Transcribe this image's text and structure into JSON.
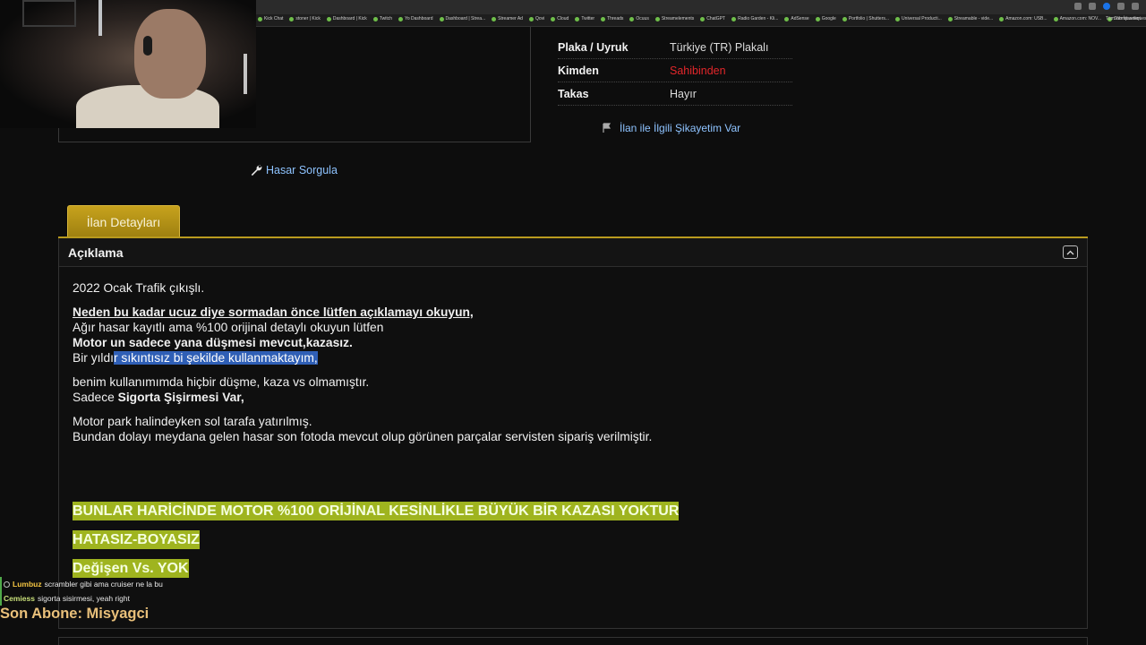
{
  "browser": {
    "bookmarks": [
      "Kick Chat",
      "stoner | Kick",
      "Dashboard | Kick",
      "Twitch",
      "Yo Dashboard",
      "Dashboard | Strea...",
      "Streamer Ad",
      "Qovi",
      "Cloud",
      "Twitter",
      "Threads",
      "Ocuus",
      "Streamelements",
      "ChatGPT",
      "Radio Garden - Kli...",
      "AdSense",
      "Google",
      "Portfolio | Shutters...",
      "Universal Producti...",
      "Streamable - vide...",
      "Amazon.com: USB...",
      "Amazon.com: NOV...",
      "Submit a request...",
      "Drive & Listen"
    ],
    "bookmarks_more": "Tüm Yer İşaretleri"
  },
  "info": {
    "rows": [
      {
        "key": "Plaka / Uyruk",
        "value": "Türkiye (TR) Plakalı"
      },
      {
        "key": "Kimden",
        "value": "Sahibinden"
      },
      {
        "key": "Takas",
        "value": "Hayır"
      }
    ],
    "complaint_link": "İlan ile İlgili Şikayetim Var"
  },
  "hasar_link": "Hasar Sorgula",
  "tab_label": "İlan Detayları",
  "section_title": "Açıklama",
  "description": {
    "line1": "2022 Ocak Trafik çıkışlı.",
    "line2": "Neden bu kadar ucuz  diye sormadan önce lütfen açıklamayı okuyun,",
    "line3": "Ağır hasar kayıtlı ama %100 orijinal detaylı okuyun lütfen",
    "line4": "Motor un sadece yana düşmesi mevcut,kazasız.",
    "line5_a": "Bir yıldı",
    "line5_b": "r sıkıntısız bi şekilde kullanmaktayım,",
    "line6": "benim kullanımımda hiçbir düşme, kaza vs olmamıştır.",
    "line7_a": "Sadece ",
    "line7_b": "Sigorta Şişirmesi Var,",
    "line8": "Motor park halindeyken sol tarafa yatırılmış.",
    "line9": "Bundan dolayı meydana gelen hasar son fotoda mevcut olup görünen parçalar servisten sipariş verilmiştir.",
    "hl1": "BUNLAR HARİCİNDE MOTOR %100 ORİJİNAL KESİNLİKLE BÜYÜK BİR KAZASI YOKTUR",
    "hl2": "HATASIZ-BOYASIZ",
    "hl3": "Değişen Vs. YOK"
  },
  "chat": [
    {
      "user": "Lumbuz",
      "message": "scrambler gibi ama cruiser ne la bu"
    },
    {
      "user": "Cemiess",
      "message": "sigorta sisirmesi, yeah right"
    }
  ],
  "subscriber": "Son Abone: Misyagci",
  "colors": {
    "accent": "#c7a21d",
    "link": "#8ec3ff",
    "red": "#e2262a",
    "highlight": "#9fb41f",
    "selection": "#2f5fb6"
  }
}
